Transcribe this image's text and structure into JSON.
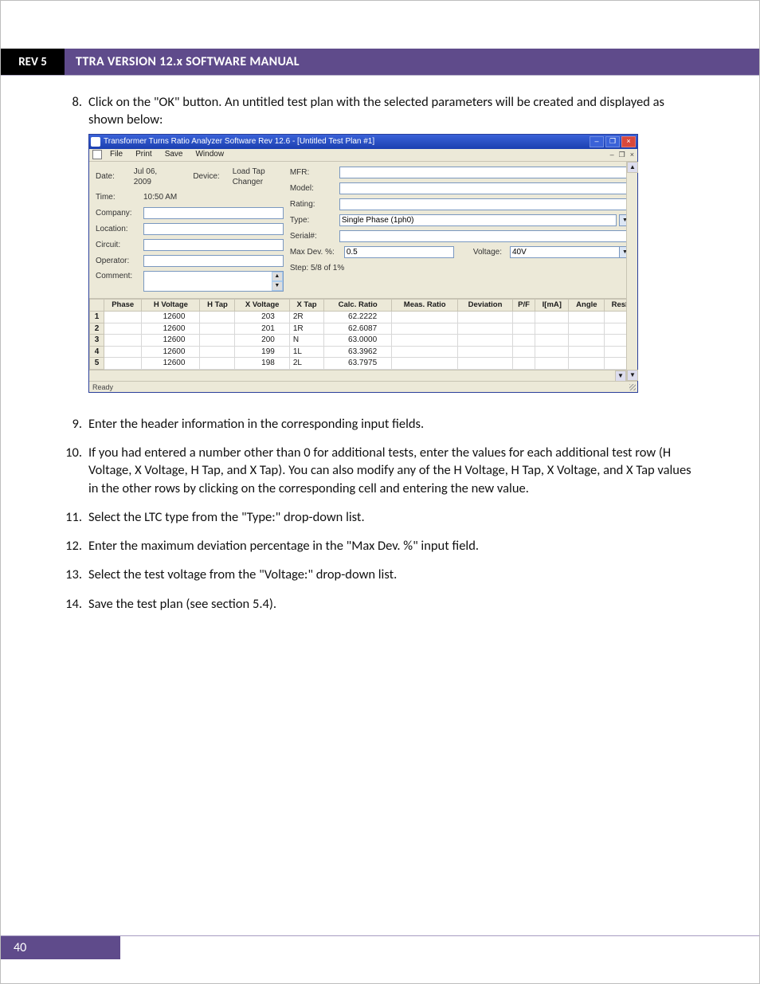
{
  "doc_header": {
    "rev": "REV 5",
    "title": "TTRA VERSION 12.x SOFTWARE MANUAL"
  },
  "page_number": "40",
  "steps": {
    "s8": {
      "num": "8.",
      "text": "Click on the \"OK\" button. An untitled test plan with the selected parameters will be created and displayed as shown below:"
    },
    "s9": {
      "num": "9.",
      "text": "Enter the header information in the corresponding input fields."
    },
    "s10": {
      "num": "10.",
      "text": "If you had entered a number other than 0 for additional tests, enter the values for each additional test row (H Voltage, X Voltage, H Tap, and X Tap). You can also modify any of the H Voltage, H Tap, X Voltage, and X Tap values in the other rows by clicking on the corresponding cell and entering the new value."
    },
    "s11": {
      "num": "11.",
      "text": "Select the LTC type from the \"Type:\" drop-down list."
    },
    "s12": {
      "num": "12.",
      "text": "Enter the maximum deviation percentage in the \"Max Dev. %\" input field."
    },
    "s13": {
      "num": "13.",
      "text": "Select the test voltage from the \"Voltage:\" drop-down list."
    },
    "s14": {
      "num": "14.",
      "text": "Save the test plan (see section 5.4)."
    }
  },
  "app": {
    "title": "Transformer Turns Ratio Analyzer Software Rev 12.6 - [Untitled Test Plan #1]",
    "menus": {
      "file": "File",
      "print": "Print",
      "save": "Save",
      "window": "Window"
    },
    "mdi_ctrls": {
      "min": "–",
      "restore": "❐",
      "close": "×"
    },
    "left": {
      "date_label": "Date:",
      "date_value": "Jul 06, 2009",
      "time_label": "Time:",
      "time_value": "10:50 AM",
      "device_label": "Device:",
      "device_value": "Load Tap Changer",
      "company_label": "Company:",
      "location_label": "Location:",
      "circuit_label": "Circuit:",
      "operator_label": "Operator:",
      "comment_label": "Comment:"
    },
    "right": {
      "mfr_label": "MFR:",
      "model_label": "Model:",
      "rating_label": "Rating:",
      "type_label": "Type:",
      "type_value": "Single Phase (1ph0)",
      "serial_label": "Serial#:",
      "maxdev_label": "Max Dev. %:",
      "maxdev_value": "0.5",
      "voltage_label": "Voltage:",
      "voltage_value": "40V",
      "step_label": "Step: 5/8 of 1%"
    },
    "grid": {
      "headers": {
        "phase": "Phase",
        "hvolt": "H Voltage",
        "htap": "H Tap",
        "xvolt": "X Voltage",
        "xtap": "X Tap",
        "calc": "Calc. Ratio",
        "meas": "Meas. Ratio",
        "dev": "Deviation",
        "pf": "P/F",
        "ima": "I[mA]",
        "angle": "Angle",
        "res": "Res□"
      },
      "rows": [
        {
          "n": "1",
          "hvolt": "12600",
          "xvolt": "203",
          "xtap": "2R",
          "calc": "62.2222"
        },
        {
          "n": "2",
          "hvolt": "12600",
          "xvolt": "201",
          "xtap": "1R",
          "calc": "62.6087"
        },
        {
          "n": "3",
          "hvolt": "12600",
          "xvolt": "200",
          "xtap": "N",
          "calc": "63.0000"
        },
        {
          "n": "4",
          "hvolt": "12600",
          "xvolt": "199",
          "xtap": "1L",
          "calc": "63.3962"
        },
        {
          "n": "5",
          "hvolt": "12600",
          "xvolt": "198",
          "xtap": "2L",
          "calc": "63.7975"
        }
      ]
    },
    "status": "Ready"
  }
}
